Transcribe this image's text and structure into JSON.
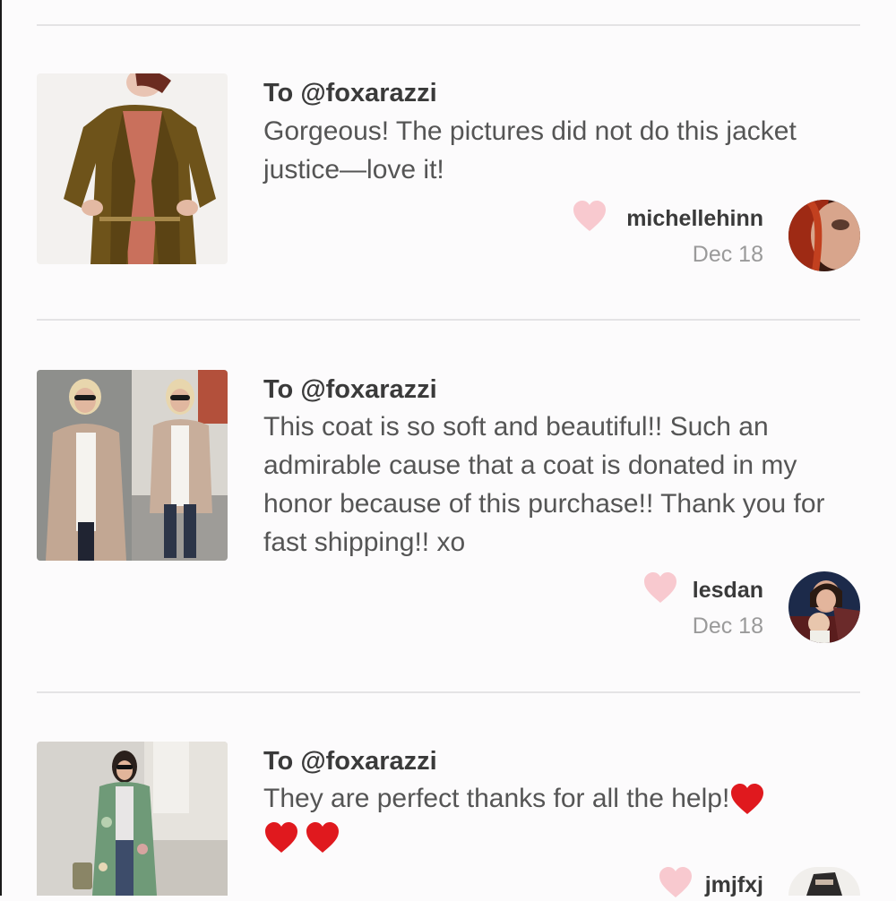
{
  "reviews": [
    {
      "to": "To @foxarazzi",
      "message": "Gorgeous! The pictures did not do this jacket justice—love it!",
      "username": "michellehinn",
      "date": "Dec 18"
    },
    {
      "to": "To @foxarazzi",
      "message": "This coat is so soft and beautiful!! Such an admirable cause that a coat is donated in my honor because of this purchase!! Thank you for fast shipping!! xo",
      "username": "lesdan",
      "date": "Dec 18"
    },
    {
      "to": "To @foxarazzi",
      "message": "They are perfect thanks for all the help!",
      "username": "jmjfxj",
      "date": ""
    }
  ],
  "colors": {
    "like_heart": "#f8c9cf",
    "emoji_heart": "#e0191e",
    "divider": "#e4e3e5",
    "background": "#fcfbfc"
  },
  "icons": {
    "like": "heart-icon",
    "emoji": "red-heart-emoji"
  }
}
